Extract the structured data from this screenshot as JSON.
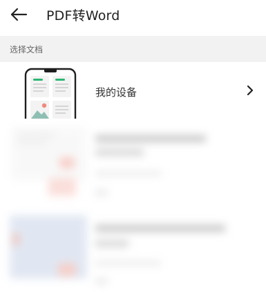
{
  "header": {
    "back_icon": "arrow-left-icon",
    "title": "PDF转Word"
  },
  "section": {
    "label": "选择文档"
  },
  "device_entry": {
    "label": "我的设备",
    "icon": "phone-documents-illustration",
    "chevron_icon": "chevron-right-icon"
  },
  "colors": {
    "accent": "#2bb673",
    "background": "#ffffff",
    "section_bg": "#f2f2f2"
  }
}
